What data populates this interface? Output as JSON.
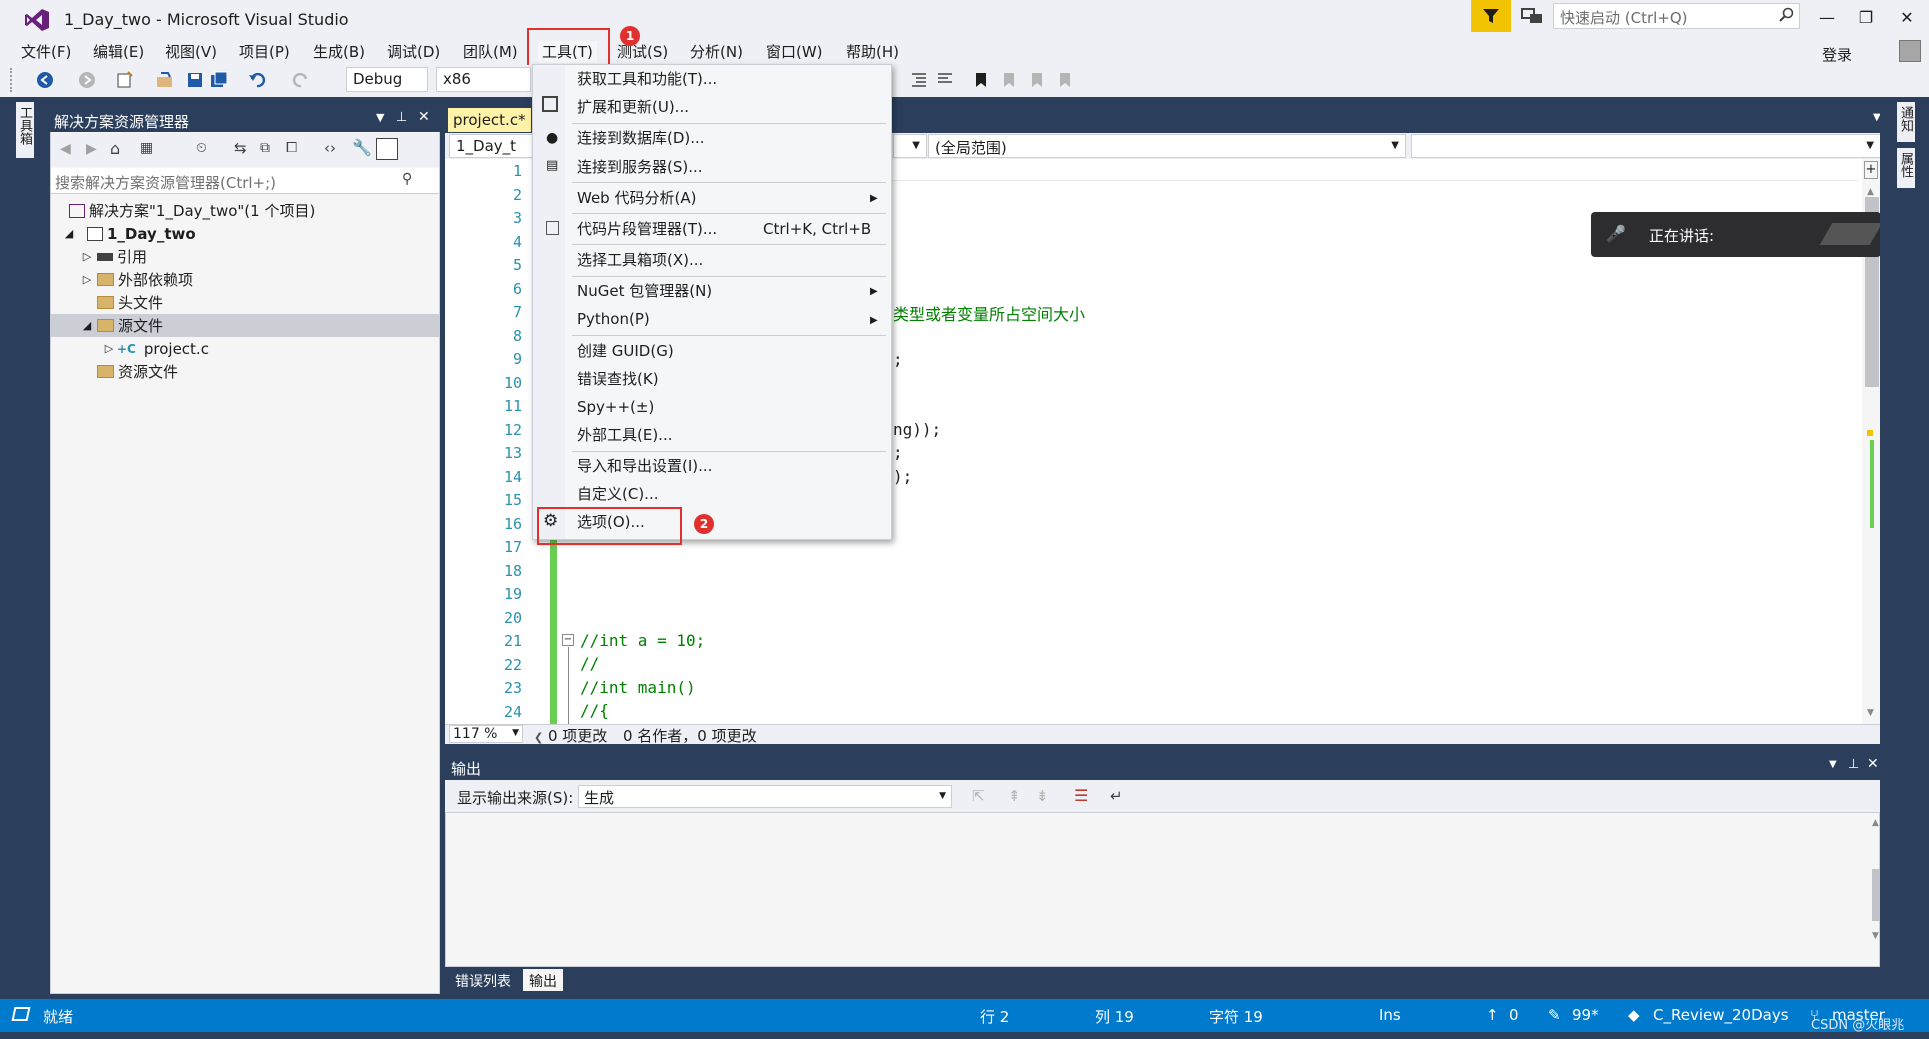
{
  "window": {
    "title": "1_Day_two - Microsoft Visual Studio",
    "quick_launch_placeholder": "快速启动 (Ctrl+Q)",
    "login": "登录",
    "minimize": "—",
    "restore": "❐",
    "close": "✕"
  },
  "menubar": [
    "文件(F)",
    "编辑(E)",
    "视图(V)",
    "项目(P)",
    "生成(B)",
    "调试(D)",
    "团队(M)",
    "工具(T)",
    "测试(S)",
    "分析(N)",
    "窗口(W)",
    "帮助(H)"
  ],
  "toolbar": {
    "config": "Debug",
    "platform": "x86"
  },
  "side_tabs": {
    "left": "工具箱",
    "right": [
      "通知",
      "属性"
    ]
  },
  "solution_explorer": {
    "title": "解决方案资源管理器",
    "search_placeholder": "搜索解决方案资源管理器(Ctrl+;)",
    "tree": [
      {
        "label": "解决方案\"1_Day_two\"(1 个项目)",
        "level": 0
      },
      {
        "label": "1_Day_two",
        "level": 1
      },
      {
        "label": "引用",
        "level": 2
      },
      {
        "label": "外部依赖项",
        "level": 2
      },
      {
        "label": "头文件",
        "level": 2
      },
      {
        "label": "源文件",
        "level": 2
      },
      {
        "label": "project.c",
        "level": 3
      },
      {
        "label": "资源文件",
        "level": 2
      }
    ]
  },
  "editor": {
    "tab": "project.c*",
    "nav_project": "1_Day_t",
    "nav_scope": "(全局范围)",
    "line_numbers": [
      "1",
      "2",
      "3",
      "4",
      "5",
      "6",
      "7",
      "8",
      "9",
      "10",
      "11",
      "12",
      "13",
      "14",
      "15",
      "16",
      "17",
      "18",
      "19",
      "20",
      "21",
      "22",
      "23",
      "24"
    ],
    "code_fragments": {
      "line7": "类型或者变量所占空间大小",
      "line9": ";",
      "line12": "ng));",
      "line13": ";",
      "line14": ");",
      "line21": "//int a = 10;",
      "line22": "//",
      "line23": "//int main()",
      "line24": "//{"
    },
    "zoom": "117 %",
    "changes": "0 项更改",
    "authors": "0 名作者，0 项更改"
  },
  "tools_menu": {
    "items": [
      {
        "label": "获取工具和功能(T)...",
        "shortcut": "",
        "submenu": false
      },
      {
        "label": "扩展和更新(U)...",
        "shortcut": "",
        "submenu": false
      },
      {
        "label": "连接到数据库(D)...",
        "shortcut": "",
        "submenu": false
      },
      {
        "label": "连接到服务器(S)...",
        "shortcut": "",
        "submenu": false
      },
      {
        "label": "Web 代码分析(A)",
        "shortcut": "",
        "submenu": true
      },
      {
        "label": "代码片段管理器(T)...",
        "shortcut": "Ctrl+K, Ctrl+B",
        "submenu": false
      },
      {
        "label": "选择工具箱项(X)...",
        "shortcut": "",
        "submenu": false
      },
      {
        "label": "NuGet 包管理器(N)",
        "shortcut": "",
        "submenu": true
      },
      {
        "label": "Python(P)",
        "shortcut": "",
        "submenu": true
      },
      {
        "label": "创建 GUID(G)",
        "shortcut": "",
        "submenu": false
      },
      {
        "label": "错误查找(K)",
        "shortcut": "",
        "submenu": false
      },
      {
        "label": "Spy++(±)",
        "shortcut": "",
        "submenu": false
      },
      {
        "label": "外部工具(E)...",
        "shortcut": "",
        "submenu": false
      },
      {
        "label": "导入和导出设置(I)...",
        "shortcut": "",
        "submenu": false
      },
      {
        "label": "自定义(C)...",
        "shortcut": "",
        "submenu": false
      },
      {
        "label": "选项(O)...",
        "shortcut": "",
        "submenu": false
      }
    ],
    "badge1": "1",
    "badge2": "2"
  },
  "toast": {
    "text": "正在讲话:"
  },
  "output": {
    "title": "输出",
    "source_label": "显示输出来源(S):",
    "source_value": "生成"
  },
  "bottom_tabs": [
    "错误列表",
    "输出"
  ],
  "statusbar": {
    "ready": "就绪",
    "row": "行 2",
    "col": "列 19",
    "char": "字符 19",
    "ins": "Ins",
    "up": "0",
    "pending": "99*",
    "repo": "C_Review_20Days",
    "branch": "master",
    "watermark": "CSDN @火眼兆"
  },
  "colors": {
    "accent": "#007acc",
    "dark_chrome": "#2b3f5c",
    "highlight_red": "#e0312e",
    "comment_green": "#008000",
    "change_green": "#6acd54"
  }
}
